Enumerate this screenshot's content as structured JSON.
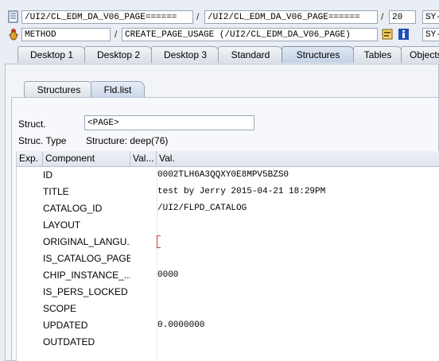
{
  "toolbar": {
    "row1": {
      "field1": "/UI2/CL_EDM_DA_V06_PAGE======",
      "sep1": "/",
      "field2": "/UI2/CL_EDM_DA_V06_PAGE======",
      "sep2": "/",
      "field3": "20",
      "field4": "SY-"
    },
    "row2": {
      "field1": "METHOD",
      "sep1": "/",
      "field2": "CREATE_PAGE_USAGE (/UI2/CL_EDM_DA_V06_PAGE)",
      "field3": "SY-"
    }
  },
  "tabs": [
    {
      "label": "Desktop 1"
    },
    {
      "label": "Desktop 2"
    },
    {
      "label": "Desktop 3"
    },
    {
      "label": "Standard"
    },
    {
      "label": "Structures"
    },
    {
      "label": "Tables"
    },
    {
      "label": "Objects"
    }
  ],
  "subtabs": [
    {
      "label": "Structures"
    },
    {
      "label": "Fld.list"
    }
  ],
  "form": {
    "struct_label": "Struct.",
    "struct_value": "<PAGE>",
    "type_label": "Struc. Type",
    "type_value": "Structure: deep(76)"
  },
  "grid": {
    "headers": {
      "exp": "Exp.",
      "component": "Component",
      "valtype": "Val...",
      "value": "Val."
    },
    "rows": [
      {
        "component": "ID",
        "value": "0002TLH6A3QQXY0E8MPV5BZS0"
      },
      {
        "component": "TITLE",
        "value": "test by Jerry 2015-04-21 18:29PM"
      },
      {
        "component": "CATALOG_ID",
        "value": "/UI2/FLPD_CATALOG"
      },
      {
        "component": "LAYOUT",
        "value": ""
      },
      {
        "component": "ORIGINAL_LANGU...",
        "value": ""
      },
      {
        "component": "IS_CATALOG_PAGE",
        "value": ""
      },
      {
        "component": "CHIP_INSTANCE_...",
        "value": "0000"
      },
      {
        "component": "IS_PERS_LOCKED",
        "value": ""
      },
      {
        "component": "SCOPE",
        "value": ""
      },
      {
        "component": "UPDATED",
        "value": "0.0000000"
      },
      {
        "component": "OUTDATED",
        "value": ""
      }
    ]
  },
  "icons": {
    "row1": "document-icon",
    "row2": "debug-bug-icon",
    "where_used": "where-used-icon",
    "info": "info-icon"
  },
  "colors": {
    "info_blue": "#1f4fb8",
    "active_tab": "#c4d2e6",
    "cursor_red": "#d43b3b"
  }
}
